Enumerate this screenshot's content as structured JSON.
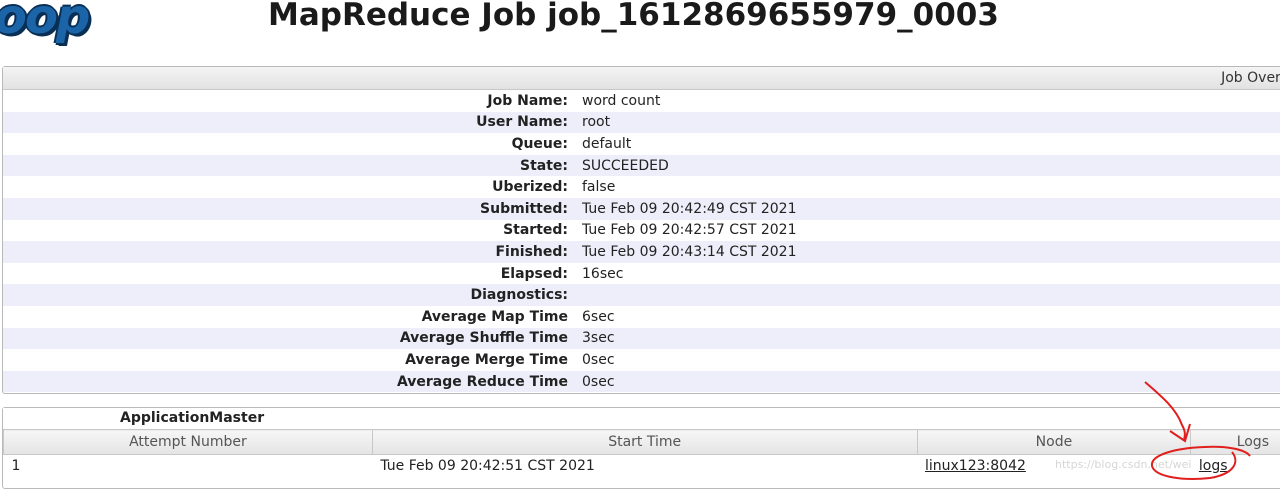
{
  "logo_text": "oop",
  "page_title": "MapReduce Job job_1612869655979_0003",
  "overview": {
    "header": "Job Overvi",
    "rows": [
      {
        "label": "Job Name:",
        "value": "word count"
      },
      {
        "label": "User Name:",
        "value": "root"
      },
      {
        "label": "Queue:",
        "value": "default"
      },
      {
        "label": "State:",
        "value": "SUCCEEDED"
      },
      {
        "label": "Uberized:",
        "value": "false"
      },
      {
        "label": "Submitted:",
        "value": "Tue Feb 09 20:42:49 CST 2021"
      },
      {
        "label": "Started:",
        "value": "Tue Feb 09 20:42:57 CST 2021"
      },
      {
        "label": "Finished:",
        "value": "Tue Feb 09 20:43:14 CST 2021"
      },
      {
        "label": "Elapsed:",
        "value": "16sec"
      },
      {
        "label": "Diagnostics:",
        "value": ""
      },
      {
        "label": "Average Map Time",
        "value": "6sec"
      },
      {
        "label": "Average Shuffle Time",
        "value": "3sec"
      },
      {
        "label": "Average Merge Time",
        "value": "0sec"
      },
      {
        "label": "Average Reduce Time",
        "value": "0sec"
      }
    ]
  },
  "application_master": {
    "title": "ApplicationMaster",
    "columns": [
      "Attempt Number",
      "Start Time",
      "Node",
      "Logs"
    ],
    "rows": [
      {
        "attempt": "1",
        "start_time": "Tue Feb 09 20:42:51 CST 2021",
        "node": "linux123:8042",
        "logs": "logs"
      }
    ]
  },
  "watermark": "https://blog.csdn.net/wei"
}
